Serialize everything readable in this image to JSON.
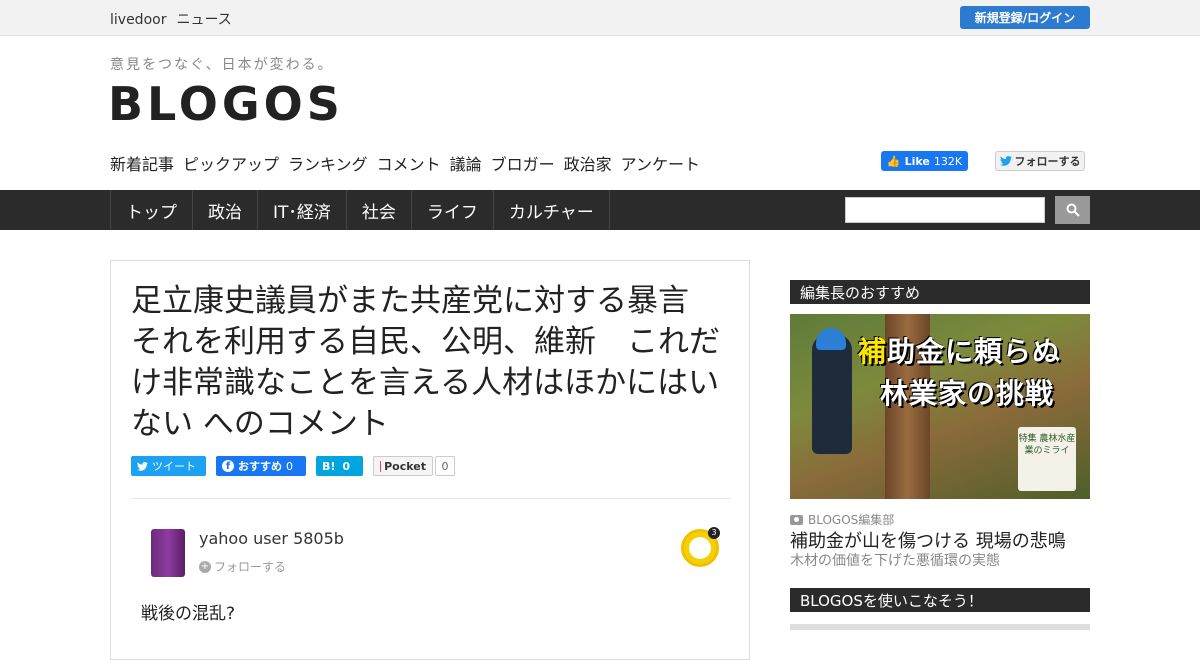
{
  "utility": {
    "brand_livedoor": "livedoor",
    "brand_news": "ニュース",
    "login_label": "新規登録/ログイン"
  },
  "header": {
    "tagline": "意見をつなぐ、日本が変わる。",
    "logo": "BLOGOS",
    "subnav": [
      "新着記事",
      "ピックアップ",
      "ランキング",
      "コメント",
      "議論",
      "ブロガー",
      "政治家",
      "アンケート"
    ],
    "fb_like_label": "Like",
    "fb_like_count": "132K",
    "tw_follow_label": "フォローする"
  },
  "mainnav": {
    "items": [
      "トップ",
      "政治",
      "IT･経済",
      "社会",
      "ライフ",
      "カルチャー"
    ],
    "search_placeholder": ""
  },
  "article": {
    "title": "足立康史議員がまた共産党に対する暴言　それを利用する自民、公明、維新　これだけ非常識なことを言える人材はほかにはいない へのコメント",
    "share": {
      "tweet_label": "ツイート",
      "fb_label": "おすすめ",
      "fb_count": "0",
      "hatena_label": "B!",
      "hatena_count": "0",
      "pocket_label": "Pocket",
      "pocket_count": "0"
    },
    "comment": {
      "user": "yahoo user 5805b",
      "follow_label": "フォローする",
      "badge_count": "3",
      "body": "戦後の混乱?"
    }
  },
  "sidebar": {
    "editor_pick_heading": "編集長のおすすめ",
    "feature": {
      "image_headline_accent": "補",
      "image_headline_line1": "助金に頼らぬ",
      "image_headline_line2": "林業家の挑戦",
      "image_card_text": "特集 農林水産業のミライ",
      "credit": "BLOGOS編集部",
      "title": "補助金が山を傷つける 現場の悲鳴",
      "subtitle": "木材の価値を下げた悪循環の実態"
    },
    "usage_heading": "BLOGOSを使いこなそう！"
  },
  "colors": {
    "login_button": "#2d7bd1",
    "nav_bg": "#2b2b2b",
    "twitter": "#1da1f2",
    "facebook": "#1877f2",
    "hatena": "#00a4de"
  }
}
